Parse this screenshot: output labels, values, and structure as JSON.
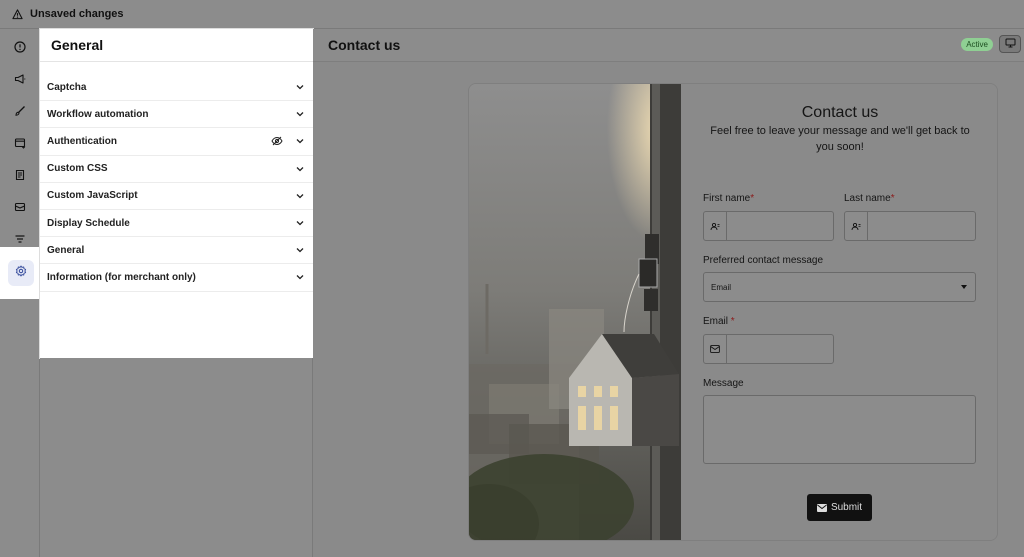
{
  "topbar": {
    "status_text": "Unsaved changes",
    "icon": "warning-icon"
  },
  "rail": {
    "items": [
      {
        "icon": "info-icon"
      },
      {
        "icon": "megaphone-icon"
      },
      {
        "icon": "brush-icon"
      },
      {
        "icon": "window-icon"
      },
      {
        "icon": "document-icon"
      },
      {
        "icon": "mail-icon"
      },
      {
        "icon": "filter-icon"
      },
      {
        "icon": "gear-icon",
        "active": true
      }
    ]
  },
  "panel": {
    "title": "General",
    "items": [
      {
        "label": "Captcha"
      },
      {
        "label": "Workflow automation"
      },
      {
        "label": "Authentication",
        "hidden_icon": "eye-off-icon"
      },
      {
        "label": "Custom CSS"
      },
      {
        "label": "Custom JavaScript"
      },
      {
        "label": "Display Schedule"
      },
      {
        "label": "General"
      },
      {
        "label": "Information (for merchant only)"
      }
    ]
  },
  "main": {
    "title": "Contact us",
    "status_badge": "Active",
    "device_icon": "desktop-icon"
  },
  "form": {
    "title": "Contact us",
    "subtitle": "Feel free to leave your message and we'll get back to you soon!",
    "first_name_label": "First name",
    "last_name_label": "Last name",
    "required_mark": "*",
    "preferred_label": "Preferred contact message",
    "preferred_value": "Email",
    "email_label": "Email",
    "email_required_mark": " *",
    "message_label": "Message",
    "submit_label": "Submit"
  },
  "colors": {
    "badge_bg": "#8fcf93",
    "submit_bg": "#111111",
    "required": "#8b1a1a",
    "active_rail": "#e8ebf7"
  }
}
